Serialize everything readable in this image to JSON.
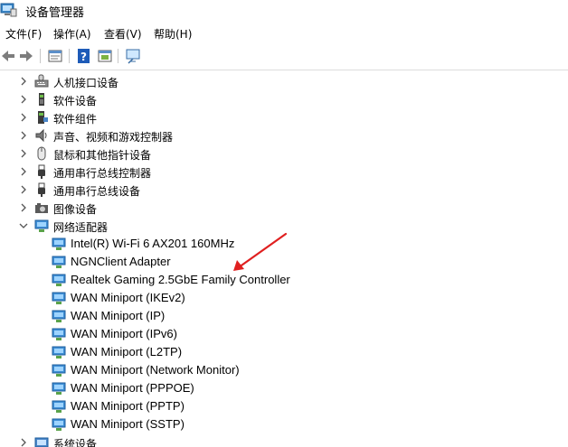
{
  "window": {
    "title": "设备管理器"
  },
  "menu": [
    {
      "label": "文件(F)"
    },
    {
      "label": "操作(A)"
    },
    {
      "label": "查看(V)"
    },
    {
      "label": "帮助(H)"
    }
  ],
  "toolbar": {
    "buttons": [
      "back-icon",
      "forward-icon",
      "properties-icon",
      "help-icon",
      "update-driver-icon",
      "monitor-icon"
    ]
  },
  "tree": {
    "categories": [
      {
        "label": "人机接口设备",
        "icon": "hid-icon",
        "expanded": false
      },
      {
        "label": "软件设备",
        "icon": "software-device-icon",
        "expanded": false
      },
      {
        "label": "软件组件",
        "icon": "software-component-icon",
        "expanded": false
      },
      {
        "label": "声音、视频和游戏控制器",
        "icon": "speaker-icon",
        "expanded": false
      },
      {
        "label": "鼠标和其他指针设备",
        "icon": "mouse-icon",
        "expanded": false
      },
      {
        "label": "通用串行总线控制器",
        "icon": "usb-icon",
        "expanded": false
      },
      {
        "label": "通用串行总线设备",
        "icon": "usb-icon",
        "expanded": false
      },
      {
        "label": "图像设备",
        "icon": "camera-icon",
        "expanded": false
      },
      {
        "label": "网络适配器",
        "icon": "network-adapter-icon",
        "expanded": true
      },
      {
        "label": "系统设备",
        "icon": "system-device-icon",
        "expanded": false
      }
    ],
    "network_adapters": [
      "Intel(R) Wi-Fi 6 AX201 160MHz",
      "NGNClient Adapter",
      "Realtek Gaming 2.5GbE Family Controller",
      "WAN Miniport (IKEv2)",
      "WAN Miniport (IP)",
      "WAN Miniport (IPv6)",
      "WAN Miniport (L2TP)",
      "WAN Miniport (Network Monitor)",
      "WAN Miniport (PPPOE)",
      "WAN Miniport (PPTP)",
      "WAN Miniport (SSTP)"
    ]
  },
  "annotation": {
    "color": "#e02020"
  }
}
